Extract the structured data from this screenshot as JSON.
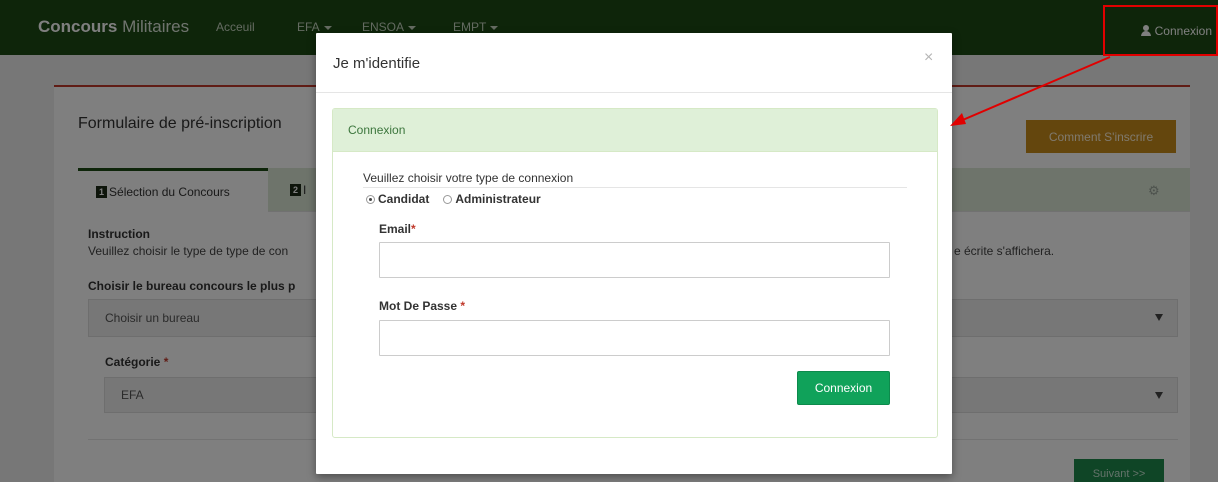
{
  "navbar": {
    "brand_bold": "Concours",
    "brand_rest": " Militaires",
    "items": [
      {
        "label": "Acceuil"
      },
      {
        "label": "EFA"
      },
      {
        "label": "ENSOA"
      },
      {
        "label": "EMPT"
      }
    ],
    "login_label": "Connexion"
  },
  "page": {
    "title": "Formulaire de pré-inscription",
    "how_to_button": "Comment S'inscrire",
    "tabs": [
      {
        "number": "1",
        "label": "Sélection du Concours"
      },
      {
        "number": "2",
        "label": "I"
      }
    ],
    "instruction_title": "Instruction",
    "instruction_text_left": "Veuillez choisir le type de type de con",
    "instruction_text_right": "e écrite s'affichera.",
    "bureau_label": "Choisir le bureau concours le plus p",
    "bureau_select_value": "Choisir un bureau",
    "category_label": "Catégorie",
    "category_required": "*",
    "category_value": "EFA",
    "next_button": "Suivant >>"
  },
  "modal": {
    "title": "Je m'identifie",
    "close": "×",
    "panel_heading": "Connexion",
    "choose_type": "Veuillez choisir votre type de connexion",
    "radio_options": [
      {
        "label": "Candidat",
        "checked": true
      },
      {
        "label": "Administrateur",
        "checked": false
      }
    ],
    "email_label": "Email",
    "email_required": "*",
    "email_value": "",
    "password_label": "Mot De Passe ",
    "password_required": "*",
    "password_value": "",
    "submit_button": "Connexion"
  },
  "colors": {
    "navbar_bg": "#1c4a14",
    "accent_green": "#10a25a",
    "panel_heading_bg": "#dff0d8",
    "panel_heading_text": "#3c763d",
    "annotation_red": "#e00000",
    "how_to_button_bg": "#c98c1b"
  },
  "icons": {
    "login": "user-icon",
    "settings": "gear-icon",
    "close": "close-icon"
  }
}
